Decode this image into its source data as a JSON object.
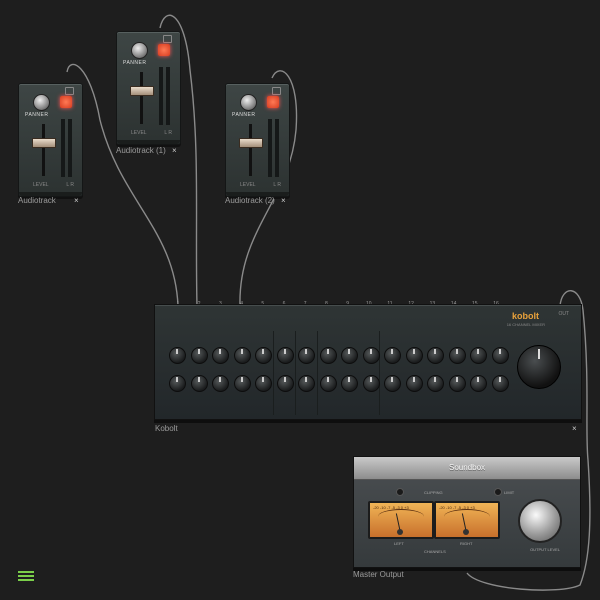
{
  "strips": [
    {
      "caption": "Audiotrack",
      "pan_label": "PANNER",
      "level_label": "LEVEL",
      "lr_label": "L  R",
      "io_icon": "io-icon"
    },
    {
      "caption": "Audiotrack (1)",
      "pan_label": "PANNER",
      "level_label": "LEVEL",
      "lr_label": "L  R",
      "io_icon": "io-icon"
    },
    {
      "caption": "Audiotrack (2)",
      "pan_label": "PANNER",
      "level_label": "LEVEL",
      "lr_label": "L  R",
      "io_icon": "io-icon"
    }
  ],
  "mixer": {
    "caption": "Kobolt",
    "logo": "kobolt",
    "subtitle": "16 CHANNEL MIXER",
    "out_label": "OUT",
    "channel_numbers": [
      "1",
      "2",
      "3",
      "4",
      "5",
      "6",
      "7",
      "8",
      "9",
      "10",
      "11",
      "12",
      "13",
      "14",
      "15",
      "16"
    ]
  },
  "master": {
    "caption": "Master Output",
    "title": "Soundbox",
    "clip_label": "CLIPPING",
    "lim_label": "LIMIT",
    "left_label": "LEFT",
    "right_label": "RIGHT",
    "channels_label": "CHANNELS",
    "output_label": "OUTPUT LEVEL",
    "vu_scale": "-20 -10 -7 -5 -3 0 +3"
  },
  "close_glyph": "×",
  "colors": {
    "background": "#1e1e1e",
    "accent": "#e9a23b",
    "menu": "#7bcf4a",
    "mute": "#e04a2b"
  }
}
